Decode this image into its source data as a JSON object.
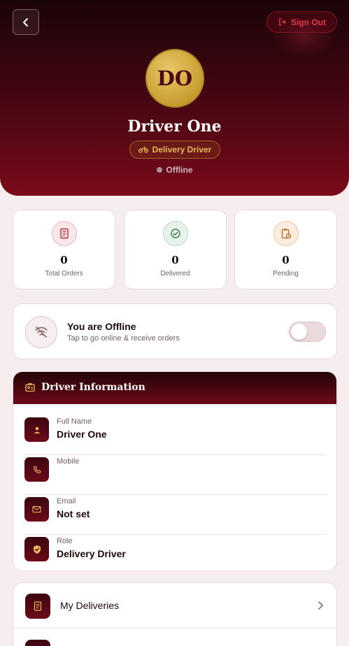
{
  "header": {
    "back_icon": "chevron-left-icon",
    "sign_out_label": "Sign Out",
    "sign_out_icon": "logout-icon",
    "avatar_initials": "DO",
    "driver_name": "Driver One",
    "role_chip_label": "Delivery Driver",
    "role_chip_icon": "motorbike-icon",
    "status_label": "Offline"
  },
  "stats": [
    {
      "value": "0",
      "label": "Total Orders",
      "icon": "receipt-icon",
      "color": "#b0303f"
    },
    {
      "value": "0",
      "label": "Delivered",
      "icon": "check-circle-icon",
      "color": "#3d7a4e"
    },
    {
      "value": "0",
      "label": "Pending",
      "icon": "clipboard-clock-icon",
      "color": "#c06a1e"
    }
  ],
  "availability": {
    "title": "You are Offline",
    "subtitle": "Tap to go online & receive orders",
    "icon": "wifi-off-icon",
    "online": false
  },
  "driver_info": {
    "title": "Driver Information",
    "icon": "id-badge-icon",
    "rows": [
      {
        "label": "Full Name",
        "value": "Driver One",
        "icon": "user-icon"
      },
      {
        "label": "Mobile",
        "value": "",
        "icon": "phone-icon"
      },
      {
        "label": "Email",
        "value": "Not set",
        "icon": "mail-icon"
      },
      {
        "label": "Role",
        "value": "Delivery Driver",
        "icon": "shield-check-icon"
      }
    ]
  },
  "menu": {
    "items": [
      {
        "label": "My Deliveries",
        "icon": "receipt-icon"
      }
    ]
  },
  "colors": {
    "accent": "#7a0a1c",
    "gold": "#e8b75a",
    "danger": "#e2394d",
    "background": "#f6eeee"
  }
}
